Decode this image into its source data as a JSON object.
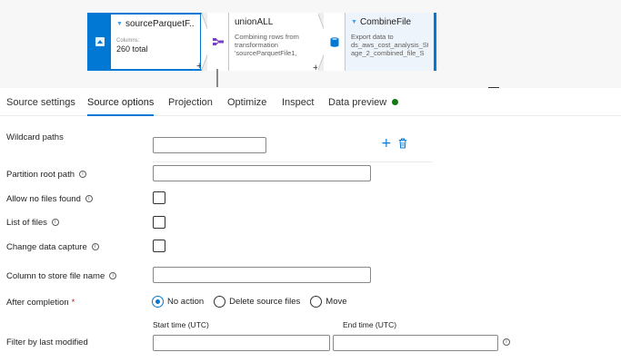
{
  "nodes": [
    {
      "title": "sourceParquetF...",
      "columns_label": "Columns:",
      "count": "260 total",
      "plus": "+"
    },
    {
      "title": "unionALL",
      "description": "Combining rows from transformation 'sourceParquetFile1,",
      "plus": "+"
    },
    {
      "title": "CombineFile",
      "description": "Export data to ds_aws_cost_analysis_St age_2_combined_file_S"
    }
  ],
  "tabs": [
    {
      "label": "Source settings"
    },
    {
      "label": "Source options"
    },
    {
      "label": "Projection"
    },
    {
      "label": "Optimize"
    },
    {
      "label": "Inspect"
    },
    {
      "label": "Data preview"
    }
  ],
  "active_tab": "Source options",
  "status_color": "#107c10",
  "accent_color": "#0078d4",
  "form": {
    "wildcard_paths": {
      "label": "Wildcard paths",
      "value": "",
      "add_icon": "plus-icon",
      "delete_icon": "trash-icon"
    },
    "partition_root_path": {
      "label": "Partition root path",
      "value": ""
    },
    "allow_no_files": {
      "label": "Allow no files found",
      "checked": false
    },
    "list_of_files": {
      "label": "List of files",
      "checked": false
    },
    "change_data_capture": {
      "label": "Change data capture",
      "checked": false
    },
    "column_to_store": {
      "label": "Column to store file name",
      "value": ""
    },
    "after_completion": {
      "label": "After completion",
      "required_mark": "*",
      "options": [
        "No action",
        "Delete source files",
        "Move"
      ],
      "selected": "No action"
    },
    "filter_last_modified": {
      "label": "Filter by last modified",
      "start_label": "Start time (UTC)",
      "end_label": "End time (UTC)",
      "start_value": "",
      "end_value": ""
    }
  }
}
